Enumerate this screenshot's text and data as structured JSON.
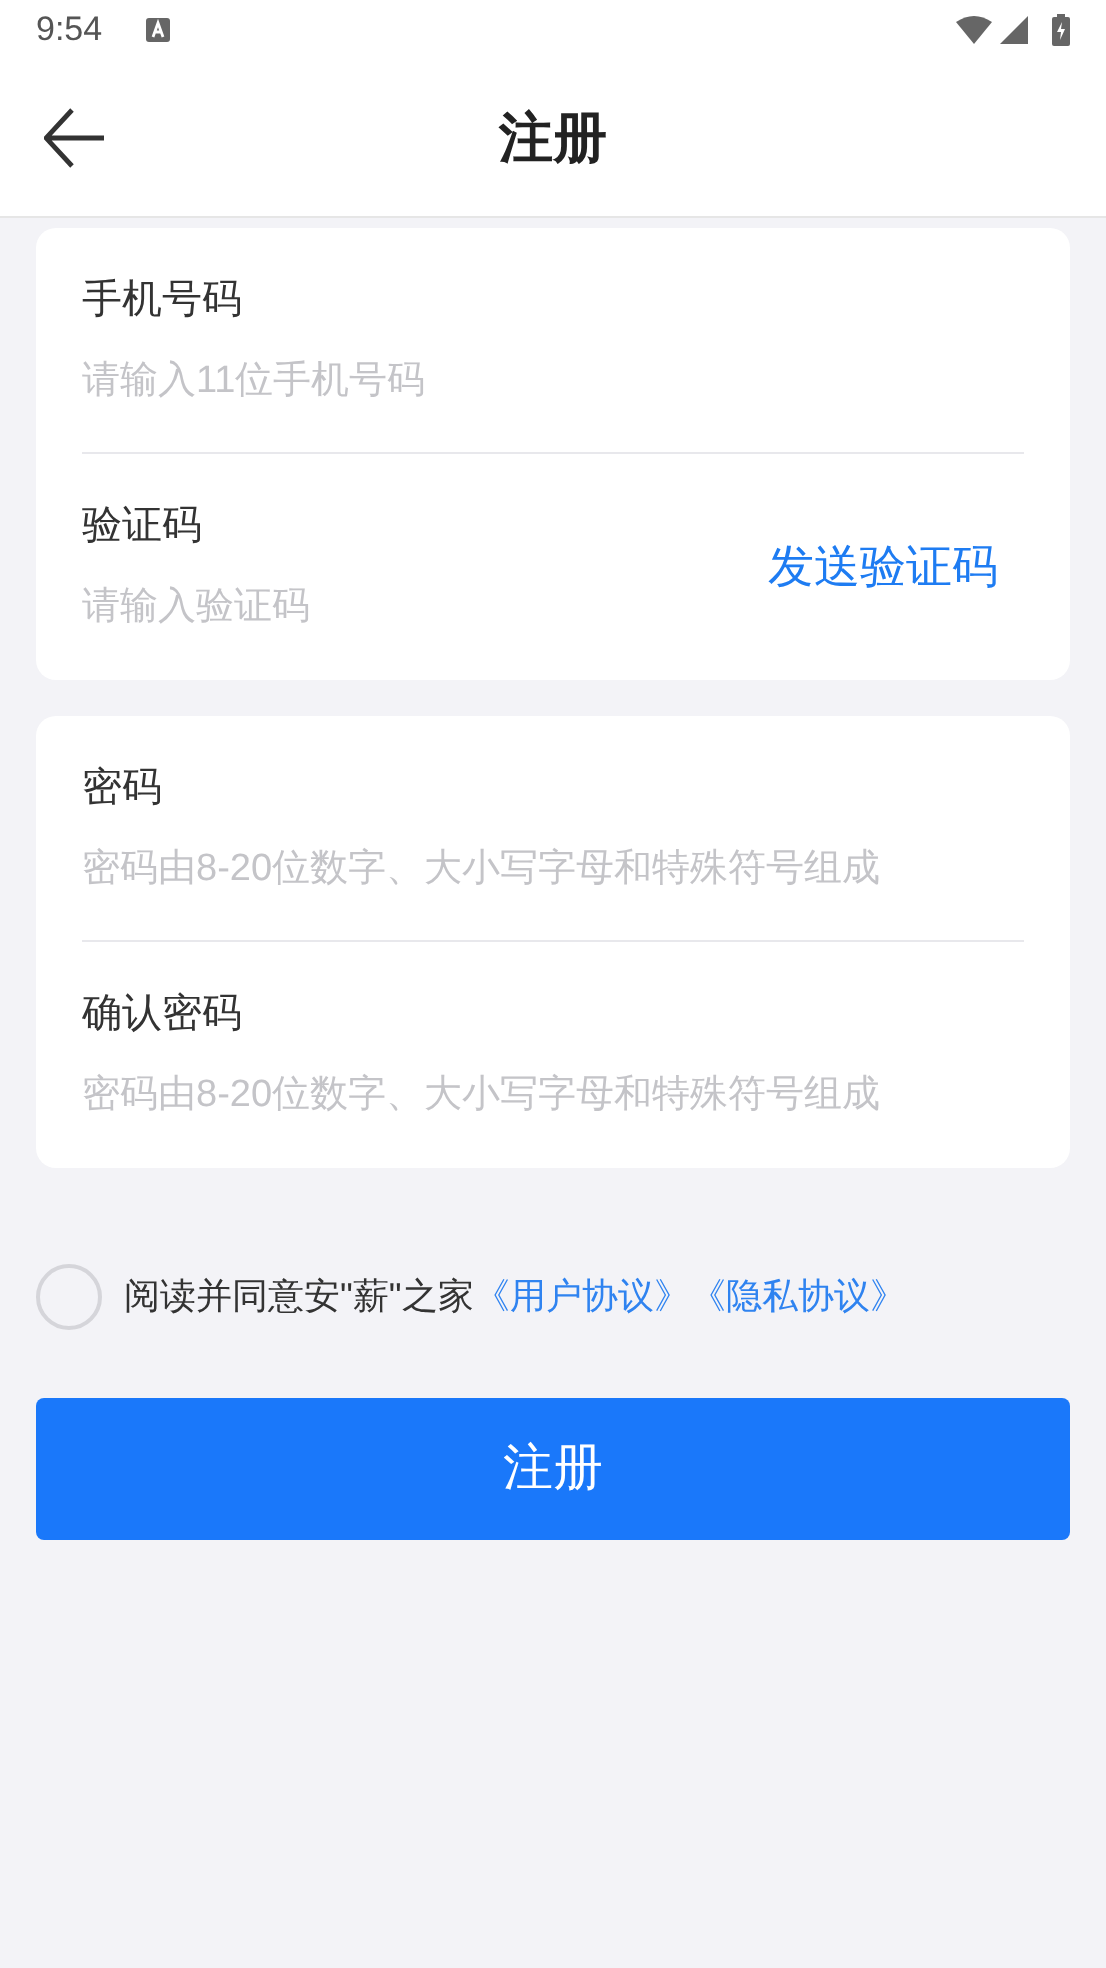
{
  "status_bar": {
    "time": "9:54"
  },
  "header": {
    "title": "注册"
  },
  "cards": [
    {
      "fields": [
        {
          "label": "手机号码",
          "placeholder": "请输入11位手机号码"
        },
        {
          "label": "验证码",
          "placeholder": "请输入验证码",
          "action": "发送验证码"
        }
      ]
    },
    {
      "fields": [
        {
          "label": "密码",
          "placeholder": "密码由8-20位数字、大小写字母和特殊符号组成"
        },
        {
          "label": "确认密码",
          "placeholder": "密码由8-20位数字、大小写字母和特殊符号组成"
        }
      ]
    }
  ],
  "agreement": {
    "checked": false,
    "text": "阅读并同意安\"薪\"之家",
    "links": [
      "《用户协议》",
      "《隐私协议》"
    ]
  },
  "submit": "注册"
}
